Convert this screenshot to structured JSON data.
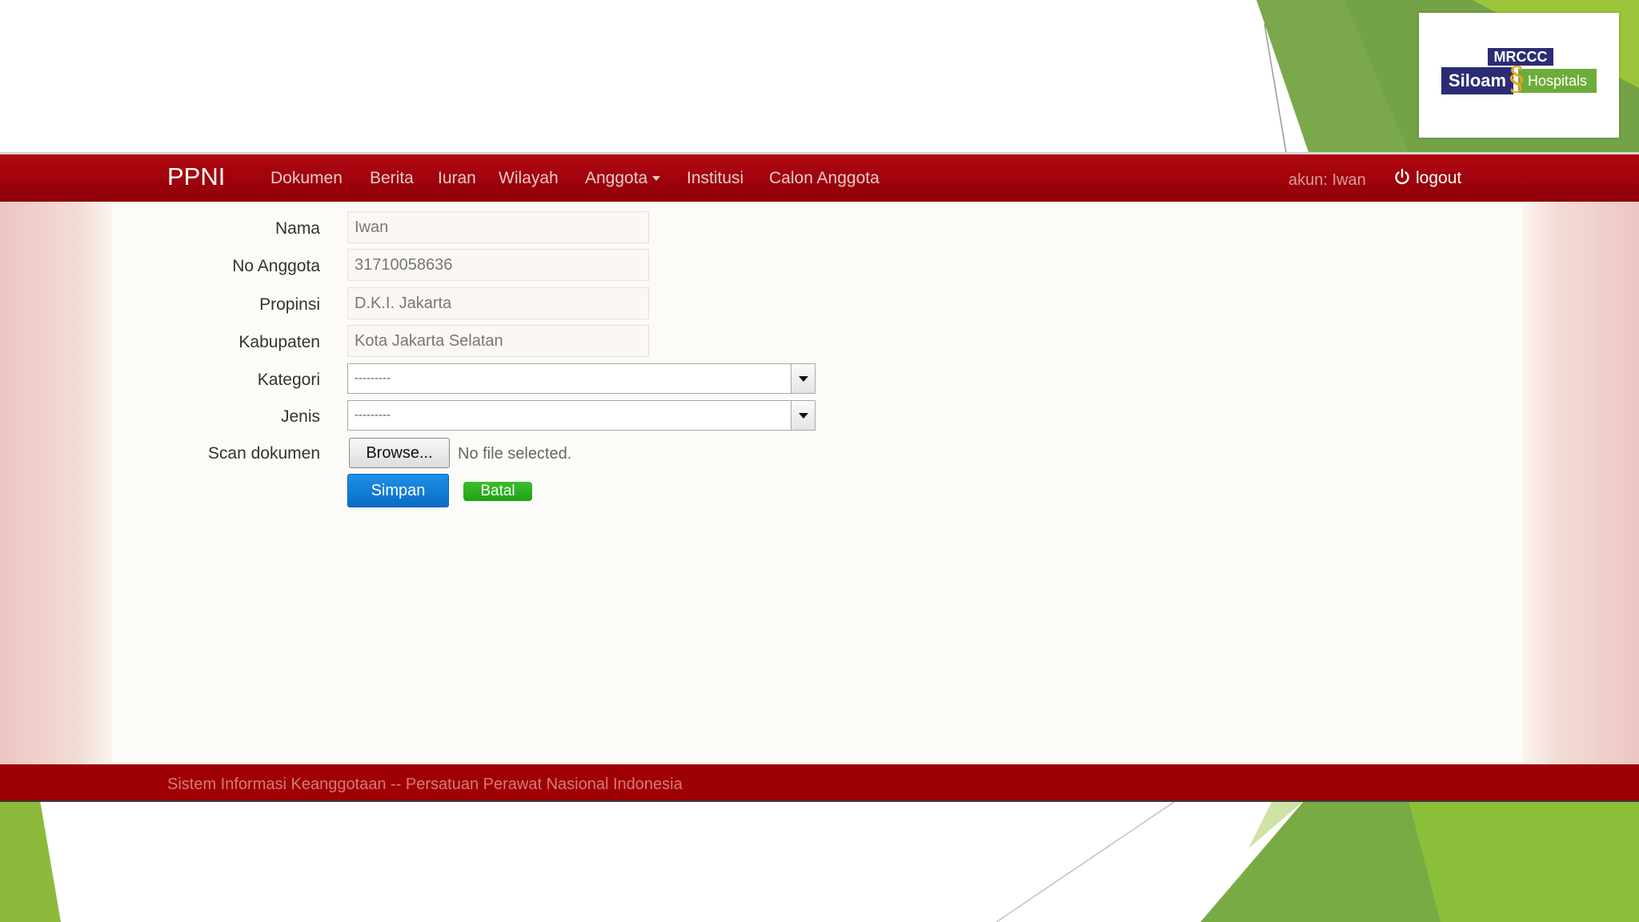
{
  "brand": "PPNI",
  "nav": {
    "items": [
      "Dokumen",
      "Berita",
      "Iuran",
      "Wilayah",
      "Anggota",
      "Institusi",
      "Calon Anggota"
    ],
    "account": "akun: Iwan",
    "logout": "logout"
  },
  "form": {
    "nama_label": "Nama",
    "nama_value": "Iwan",
    "no_anggota_label": "No Anggota",
    "no_anggota_value": "31710058636",
    "propinsi_label": "Propinsi",
    "propinsi_value": "D.K.I. Jakarta",
    "kabupaten_label": "Kabupaten",
    "kabupaten_value": "Kota Jakarta Selatan",
    "kategori_label": "Kategori",
    "kategori_value": "---------",
    "jenis_label": "Jenis",
    "jenis_value": "---------",
    "scan_label": "Scan dokumen",
    "browse_label": "Browse...",
    "no_file_text": "No file selected.",
    "simpan_label": "Simpan",
    "batal_label": "Batal"
  },
  "footer": "Sistem Informasi Keanggotaan -- Persatuan Perawat Nasional Indonesia",
  "logo": {
    "top": "MRCCC",
    "left": "Siloam",
    "right": "Hospitals"
  },
  "colors": {
    "navbar": "#a0000a",
    "primary_button": "#0a6cc6",
    "success_button": "#21a116",
    "slide_green": "#7fb03e"
  }
}
